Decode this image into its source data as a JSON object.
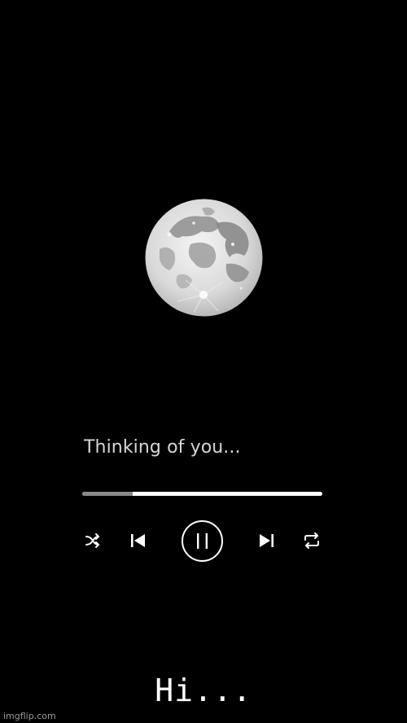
{
  "player": {
    "track_title": "Thinking of you...",
    "progress": 0.21,
    "colors": {
      "background": "#000000",
      "track": "#ffffff",
      "fill": "#8a8a8a",
      "text": "#d6d6d6"
    },
    "controls": {
      "shuffle_icon": "shuffle-icon",
      "previous_icon": "skip-previous-icon",
      "pause_icon": "pause-icon",
      "next_icon": "skip-next-icon",
      "repeat_icon": "repeat-icon"
    },
    "artwork_icon": "full-moon"
  },
  "caption": "Hi...",
  "watermark": "imgflip.com"
}
